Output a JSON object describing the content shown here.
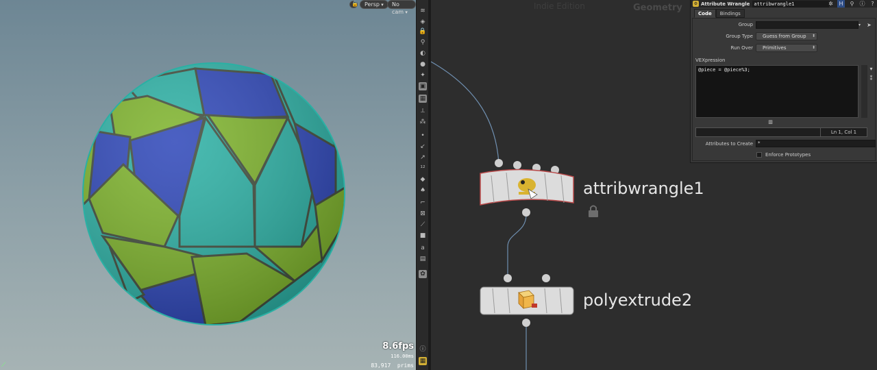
{
  "viewport": {
    "camera_view": "Persp",
    "camera": "No cam",
    "fps": "8.6fps",
    "frame_time": "116.00ms",
    "prim_count": "83,917",
    "prim_label": "prims"
  },
  "network": {
    "edition": "Indie Edition",
    "context": "Geometry",
    "nodes": [
      {
        "name": "attribwrangle1"
      },
      {
        "name": "polyextrude2"
      }
    ]
  },
  "params": {
    "node_type": "Attribute Wrangle",
    "node_name": "attribwrangle1",
    "tabs": [
      {
        "label": "Code"
      },
      {
        "label": "Bindings"
      }
    ],
    "group_label": "Group",
    "group_value": "",
    "group_type_label": "Group Type",
    "group_type_value": "Guess from Group",
    "run_over_label": "Run Over",
    "run_over_value": "Primitives",
    "vex_label": "VEXpression",
    "vex_code": "@piece = @piece%3;",
    "cursor_pos": "Ln 1, Col 1",
    "attrs_label": "Attributes to Create",
    "attrs_value": "*",
    "enforce_label": "Enforce Prototypes"
  },
  "colors": {
    "wire": "#6f8fb0",
    "node_body": "#d8d8d8",
    "green_piece": "#7db32a",
    "teal_piece": "#2ab0a4",
    "blue_piece": "#2c45b8"
  }
}
